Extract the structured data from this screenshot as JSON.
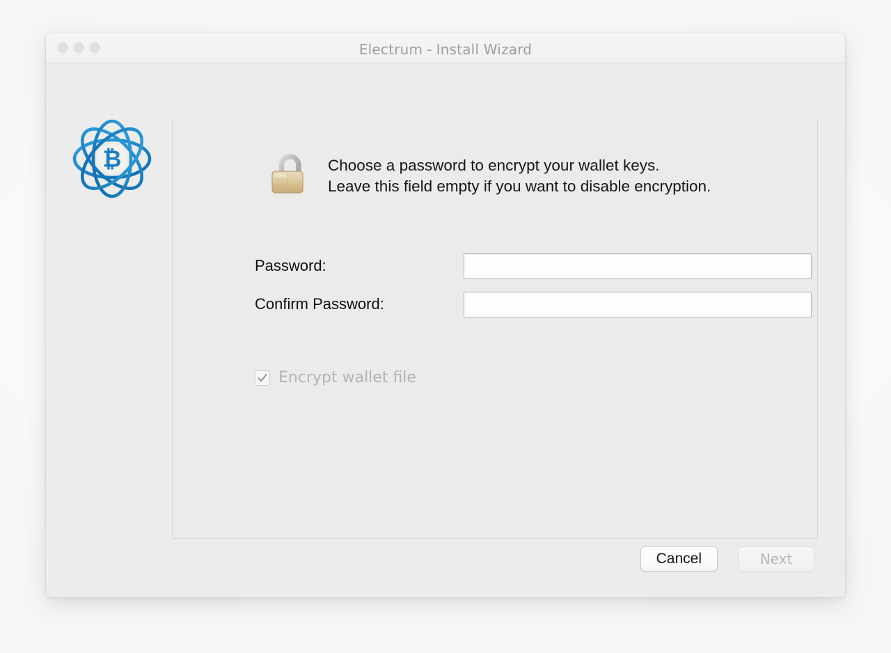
{
  "window": {
    "title_app": "Electrum",
    "title_separator": "-",
    "title_page": "Install Wizard",
    "traffic_lights": [
      "close-button",
      "minimize-button",
      "zoom-button"
    ]
  },
  "branding": {
    "logo_name": "electrum-bitcoin-atom-logo",
    "logo_color": "#1a7fc1",
    "logo_symbol": "₿"
  },
  "panel": {
    "icon_name": "open-padlock-icon",
    "message_line1": "Choose a password to encrypt your wallet keys.",
    "message_line2": "Leave this field empty if you want to disable encryption.",
    "fields": [
      {
        "label": "Password:",
        "value": "",
        "placeholder": "",
        "name": "password-input"
      },
      {
        "label": "Confirm Password:",
        "value": "",
        "placeholder": "",
        "name": "confirm-password-input"
      }
    ],
    "checkbox": {
      "label": "Encrypt wallet file",
      "checked": true,
      "enabled": false
    }
  },
  "footer": {
    "cancel_label": "Cancel",
    "next_label": "Next",
    "next_enabled": false
  },
  "colors": {
    "window_bg": "#ececec",
    "titlebar_bg": "#f2f2f3",
    "panel_bg": "#ebebeb",
    "accent_blue": "#1a7fc1",
    "lock_gold": "#d9c08a",
    "disabled_text": "#b3b3b5"
  }
}
